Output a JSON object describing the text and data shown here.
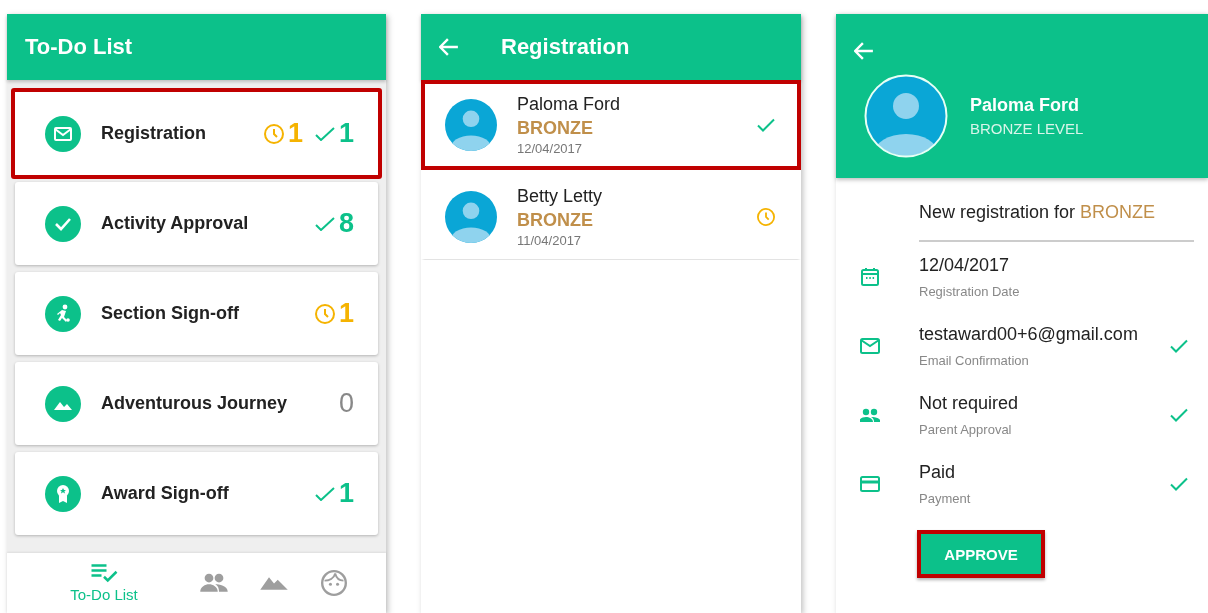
{
  "todo_screen": {
    "title": "To-Do List",
    "items": [
      {
        "label": "Registration",
        "highlighted": true,
        "counts": [
          {
            "kind": "pending",
            "value": "1"
          },
          {
            "kind": "done",
            "value": "1"
          }
        ]
      },
      {
        "label": "Activity Approval",
        "highlighted": false,
        "counts": [
          {
            "kind": "done",
            "value": "8"
          }
        ]
      },
      {
        "label": "Section Sign-off",
        "highlighted": false,
        "counts": [
          {
            "kind": "pending",
            "value": "1"
          }
        ]
      },
      {
        "label": "Adventurous Journey",
        "highlighted": false,
        "counts": [
          {
            "kind": "plain",
            "value": "0"
          }
        ]
      },
      {
        "label": "Award Sign-off",
        "highlighted": false,
        "counts": [
          {
            "kind": "done",
            "value": "1"
          }
        ]
      }
    ],
    "bottom_nav": [
      {
        "label": "To-Do List",
        "selected": true
      },
      {
        "selected": false
      },
      {
        "selected": false
      },
      {
        "selected": false
      }
    ]
  },
  "registration_screen": {
    "title": "Registration",
    "rows": [
      {
        "name": "Paloma Ford",
        "level": "BRONZE",
        "date": "12/04/2017",
        "kind": "done",
        "highlighted": true
      },
      {
        "name": "Betty Letty",
        "level": "BRONZE",
        "date": "11/04/2017",
        "kind": "pending",
        "highlighted": false
      }
    ]
  },
  "detail_screen": {
    "name": "Paloma Ford",
    "level": "BRONZE LEVEL",
    "heading": "New registration for",
    "heading_level": "BRONZE",
    "fields": [
      {
        "value": "12/04/2017",
        "label": "Registration Date",
        "checked": false
      },
      {
        "value": "testaward00+6@gmail.com",
        "label": "Email Confirmation",
        "checked": true
      },
      {
        "value": "Not required",
        "label": "Parent Approval",
        "checked": true
      },
      {
        "value": "Paid",
        "label": "Payment",
        "checked": true
      }
    ],
    "button": {
      "label": "APPROVE",
      "highlighted": true
    }
  }
}
